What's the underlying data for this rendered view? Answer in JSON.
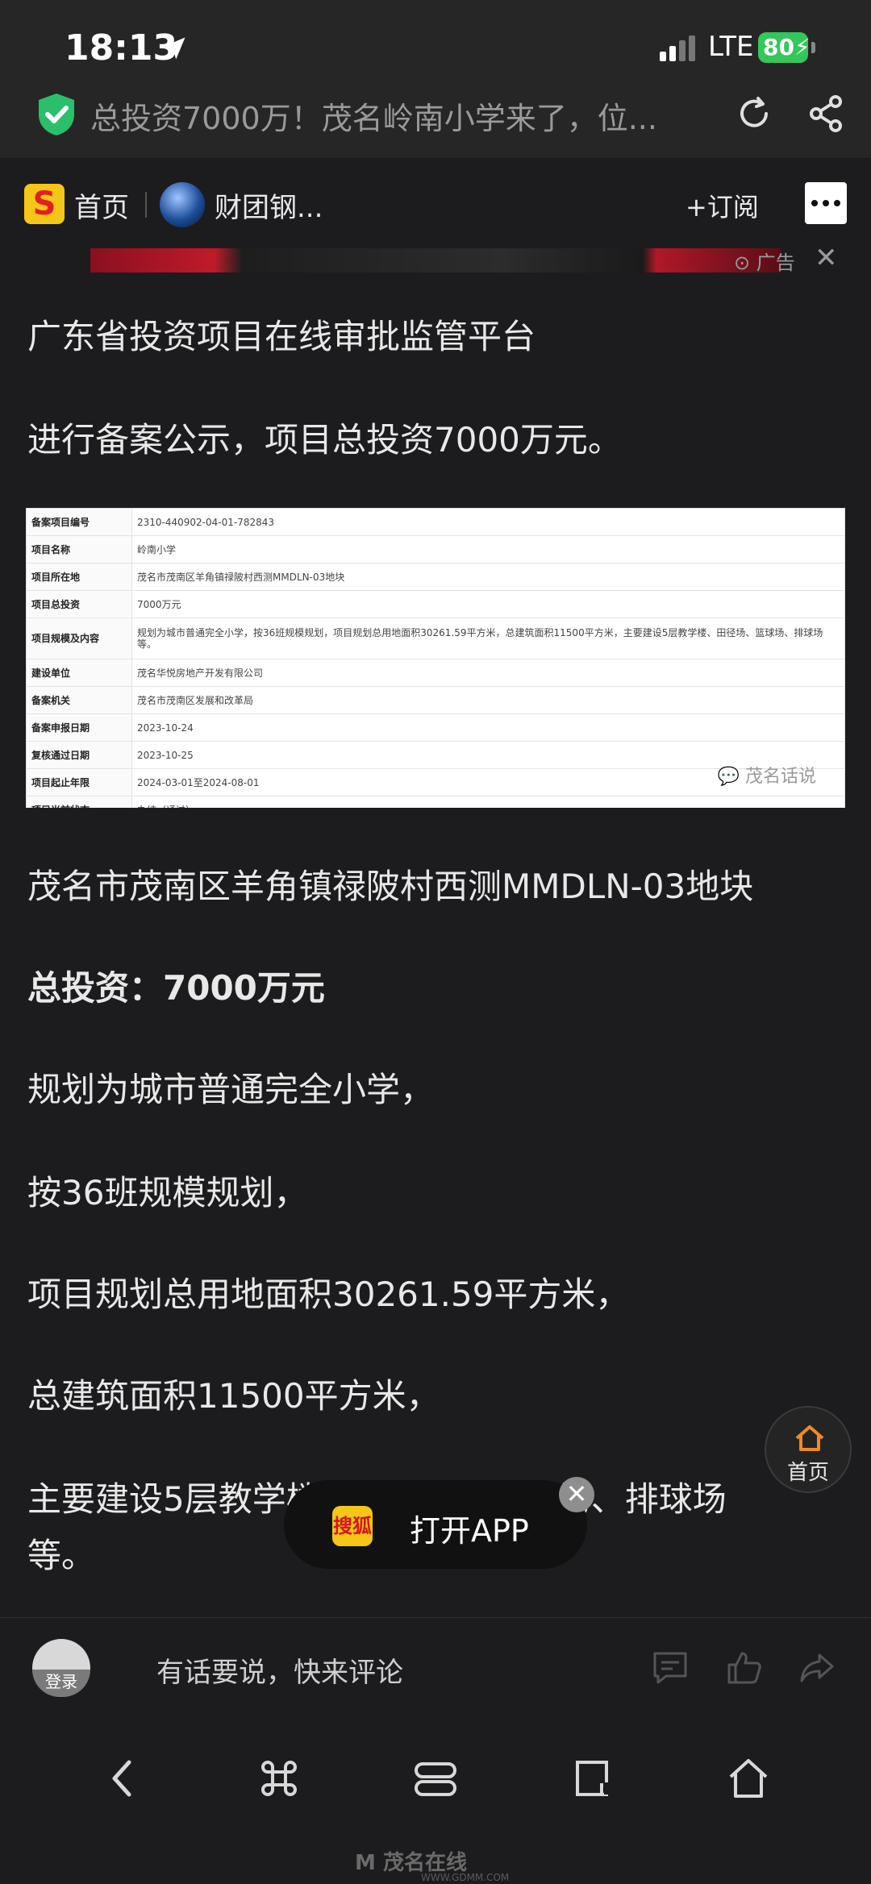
{
  "status_bar": {
    "time": "18:13",
    "network": "LTE",
    "battery": "80"
  },
  "address_bar": {
    "title": "总投资7000万！茂名岭南小学来了，位..."
  },
  "top_nav": {
    "home": "首页",
    "channel": "财团钢...",
    "subscribe": "+订阅"
  },
  "ad": {
    "label": "广告"
  },
  "article": {
    "p1": "广东省投资项目在线审批监管平台",
    "p2": "进行备案公示，项目总投资7000万元。",
    "record_table": [
      {
        "key": "备案项目编号",
        "value": "2310-440902-04-01-782843"
      },
      {
        "key": "项目名称",
        "value": "岭南小学"
      },
      {
        "key": "项目所在地",
        "value": "茂名市茂南区羊角镇禄陂村西测MMDLN-03地块"
      },
      {
        "key": "项目总投资",
        "value": "7000万元"
      },
      {
        "key": "项目规模及内容",
        "value": "规划为城市普通完全小学，按36班规模规划，项目规划总用地面积30261.59平方米，总建筑面积11500平方米，主要建设5层教学楼、田径场、篮球场、排球场等。"
      },
      {
        "key": "建设单位",
        "value": "茂名华悦房地产开发有限公司"
      },
      {
        "key": "备案机关",
        "value": "茂名市茂南区发展和改革局"
      },
      {
        "key": "备案申报日期",
        "value": "2023-10-24"
      },
      {
        "key": "复核通过日期",
        "value": "2023-10-25"
      },
      {
        "key": "项目起止年限",
        "value": "2024-03-01至2024-08-01"
      },
      {
        "key": "项目当前状态",
        "value": "办结（通过）"
      }
    ],
    "table_watermark": "茂名话说",
    "p3": "茂名市茂南区羊角镇禄陂村西测MMDLN-03地块",
    "p4": "总投资：7000万元",
    "p5": "规划为城市普通完全小学，",
    "p6": "按36班规模规划，",
    "p7": "项目规划总用地面积30261.59平方米，",
    "p8": "总建筑面积11500平方米，",
    "p9a": "主要建设5层教学楼、田径场、篮球场、排球场",
    "p9b": "等。"
  },
  "floating_home": {
    "label": "首页"
  },
  "open_app": {
    "logo": "搜狐",
    "label": "打开APP"
  },
  "comment_bar": {
    "login": "登录",
    "placeholder": "有话要说，快来评论"
  },
  "footer_watermark": {
    "name": "茂名在线",
    "url": "WWW.GDMM.COM"
  }
}
